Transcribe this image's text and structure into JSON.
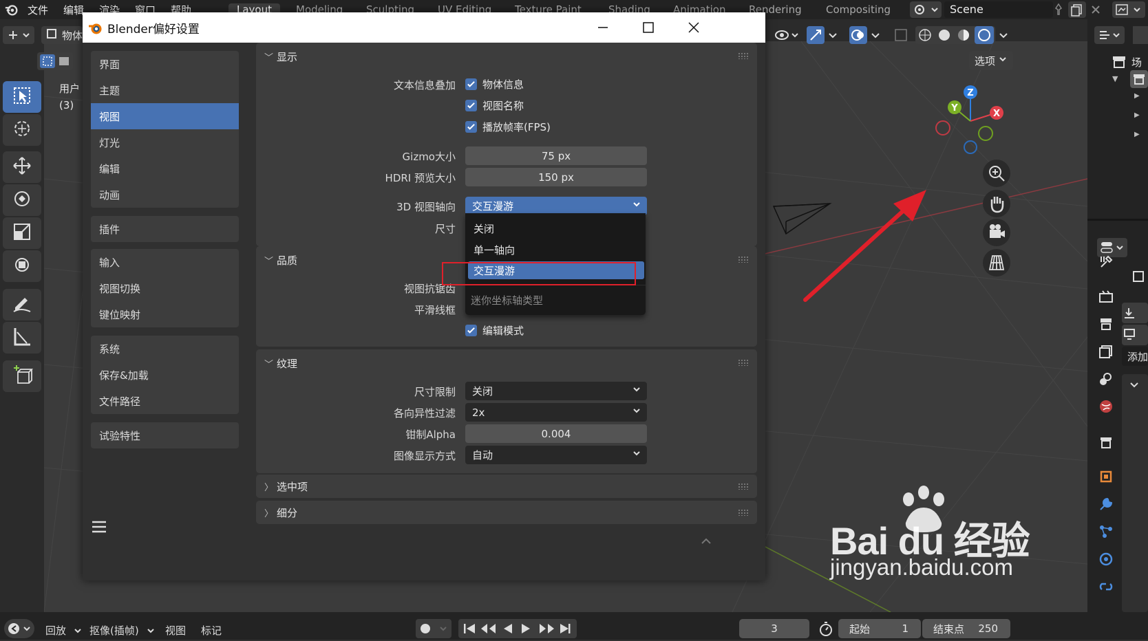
{
  "menubar": {
    "items": [
      "文件",
      "编辑",
      "渲染",
      "窗口",
      "帮助"
    ],
    "workspaces": [
      "Layout",
      "Modeling",
      "Sculpting",
      "UV Editing",
      "Texture Paint",
      "Shading",
      "Animation",
      "Rendering",
      "Compositing"
    ],
    "active_workspace": "Layout",
    "scene_name": "Scene"
  },
  "viewport": {
    "options_label": "选项",
    "overlay_text_line1": "用户",
    "overlay_text_line2": "(3)",
    "object_mode_label": "物体",
    "gizmo_axes": {
      "x": "X",
      "y": "Y",
      "z": "Z"
    }
  },
  "right_panel": {
    "scene_label": "场景",
    "add_label": "添加"
  },
  "timeline": {
    "playback_label": "回放",
    "keying_label": "抠像(插帧)",
    "view_label": "视图",
    "marker_label": "标记",
    "current_frame": "3",
    "start_label": "起始",
    "start_value": "1",
    "end_label": "结束点",
    "end_value": "250"
  },
  "prefs": {
    "window_title": "Blender偏好设置",
    "nav_groups": [
      [
        "界面",
        "主题",
        "视图",
        "灯光",
        "编辑",
        "动画"
      ],
      [
        "插件"
      ],
      [
        "输入",
        "视图切换",
        "键位映射"
      ],
      [
        "系统",
        "保存&加载",
        "文件路径"
      ],
      [
        "试验特性"
      ]
    ],
    "nav_active": "视图",
    "display": {
      "title": "显示",
      "text_info_label": "文本信息叠加",
      "checks": [
        "物体信息",
        "视图名称",
        "播放帧率(FPS)"
      ],
      "gizmo_size_label": "Gizmo大小",
      "gizmo_size_value": "75 px",
      "hdri_label": "HDRI 预览大小",
      "hdri_value": "150 px",
      "axis_label": "3D 视图轴向",
      "axis_value": "交互漫游",
      "size_label": "尺寸"
    },
    "dropdown": {
      "options": [
        "关闭",
        "单一轴向",
        "交互漫游"
      ],
      "selected": "交互漫游",
      "section_hint": "迷你坐标轴类型"
    },
    "quality": {
      "title": "品质",
      "aa_label": "视图抗锯齿",
      "smooth_label": "平滑线框",
      "edit_mode_label": "编辑模式"
    },
    "texture": {
      "title": "纹理",
      "size_limit_label": "尺寸限制",
      "size_limit_value": "关闭",
      "aniso_label": "各向异性过滤",
      "aniso_value": "2x",
      "clip_alpha_label": "钳制Alpha",
      "clip_alpha_value": "0.004",
      "image_display_label": "图像显示方式",
      "image_display_value": "自动"
    },
    "selection": {
      "title": "选中项"
    },
    "subdivision": {
      "title": "细分"
    }
  },
  "watermark": {
    "brand": "Bai du 经验",
    "url": "jingyan.baidu.com"
  },
  "colors": {
    "accent": "#4772b3",
    "highlight_box": "#e0202a",
    "arrow": "#e0202a"
  }
}
